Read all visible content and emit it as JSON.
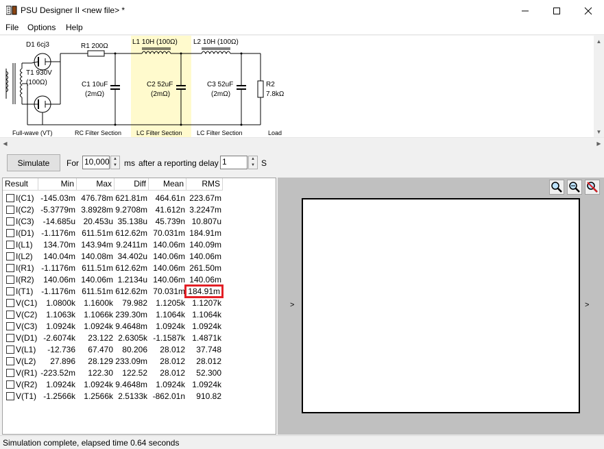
{
  "window": {
    "title": "PSU Designer II  <new file>  *"
  },
  "menu": [
    "File",
    "Options",
    "Help"
  ],
  "schematic": {
    "rectifier": "D1 6cj3",
    "transformer": [
      "T1 930V",
      "(100Ω)"
    ],
    "r1": "R1 200Ω",
    "l1": "L1 10H (100Ω)",
    "l2": "L2 10H (100Ω)",
    "c1": [
      "C1 10uF",
      "(2mΩ)"
    ],
    "c2": [
      "C2 52uF",
      "(2mΩ)"
    ],
    "c3": [
      "C3 52uF",
      "(2mΩ)"
    ],
    "r2": [
      "R2",
      "7.8kΩ"
    ],
    "sections": [
      "Full-wave (VT)",
      "RC Filter Section",
      "LC Filter Section",
      "LC Filter Section",
      "Load"
    ],
    "highlight_color": "#fffacd"
  },
  "controls": {
    "simulate": "Simulate",
    "for": "For",
    "duration": "10,000",
    "ms": "ms",
    "delay_label": "after a reporting delay of",
    "delay": "1",
    "s": "S"
  },
  "results": {
    "columns": [
      "Result",
      "Min",
      "Max",
      "Diff",
      "Mean",
      "RMS"
    ],
    "rows": [
      [
        "I(C1)",
        "-145.03m",
        "476.78m",
        "621.81m",
        "464.61n",
        "223.67m"
      ],
      [
        "I(C2)",
        "-5.3779m",
        "3.8928m",
        "9.2708m",
        "41.612n",
        "3.2247m"
      ],
      [
        "I(C3)",
        "-14.685u",
        "20.453u",
        "35.138u",
        "45.739n",
        "10.807u"
      ],
      [
        "I(D1)",
        "-1.1176m",
        "611.51m",
        "612.62m",
        "70.031m",
        "184.91m"
      ],
      [
        "I(L1)",
        "134.70m",
        "143.94m",
        "9.2411m",
        "140.06m",
        "140.09m"
      ],
      [
        "I(L2)",
        "140.04m",
        "140.08m",
        "34.402u",
        "140.06m",
        "140.06m"
      ],
      [
        "I(R1)",
        "-1.1176m",
        "611.51m",
        "612.62m",
        "140.06m",
        "261.50m"
      ],
      [
        "I(R2)",
        "140.06m",
        "140.06m",
        "1.2134u",
        "140.06m",
        "140.06m"
      ],
      [
        "I(T1)",
        "-1.1176m",
        "611.51m",
        "612.62m",
        "70.031m",
        "184.91m"
      ],
      [
        "V(C1)",
        "1.0800k",
        "1.1600k",
        "79.982",
        "1.1205k",
        "1.1207k"
      ],
      [
        "V(C2)",
        "1.1063k",
        "1.1066k",
        "239.30m",
        "1.1064k",
        "1.1064k"
      ],
      [
        "V(C3)",
        "1.0924k",
        "1.0924k",
        "9.4648m",
        "1.0924k",
        "1.0924k"
      ],
      [
        "V(D1)",
        "-2.6074k",
        "23.122",
        "2.6305k",
        "-1.1587k",
        "1.4871k"
      ],
      [
        "V(L1)",
        "-12.736",
        "67.470",
        "80.206",
        "28.012",
        "37.748"
      ],
      [
        "V(L2)",
        "27.896",
        "28.129",
        "233.09m",
        "28.012",
        "28.012"
      ],
      [
        "V(R1)",
        "-223.52m",
        "122.30",
        "122.52",
        "28.012",
        "52.300"
      ],
      [
        "V(R2)",
        "1.0924k",
        "1.0924k",
        "9.4648m",
        "1.0924k",
        "1.0924k"
      ],
      [
        "V(T1)",
        "-1.2566k",
        "1.2566k",
        "2.5133k",
        "-862.01n",
        "910.82"
      ]
    ],
    "highlight": {
      "row": 8,
      "col": 5,
      "color": "#e31f26"
    }
  },
  "plot": {
    "left_arrow": ">",
    "right_arrow": ">"
  },
  "status": "Simulation complete, elapsed time 0.64 seconds"
}
